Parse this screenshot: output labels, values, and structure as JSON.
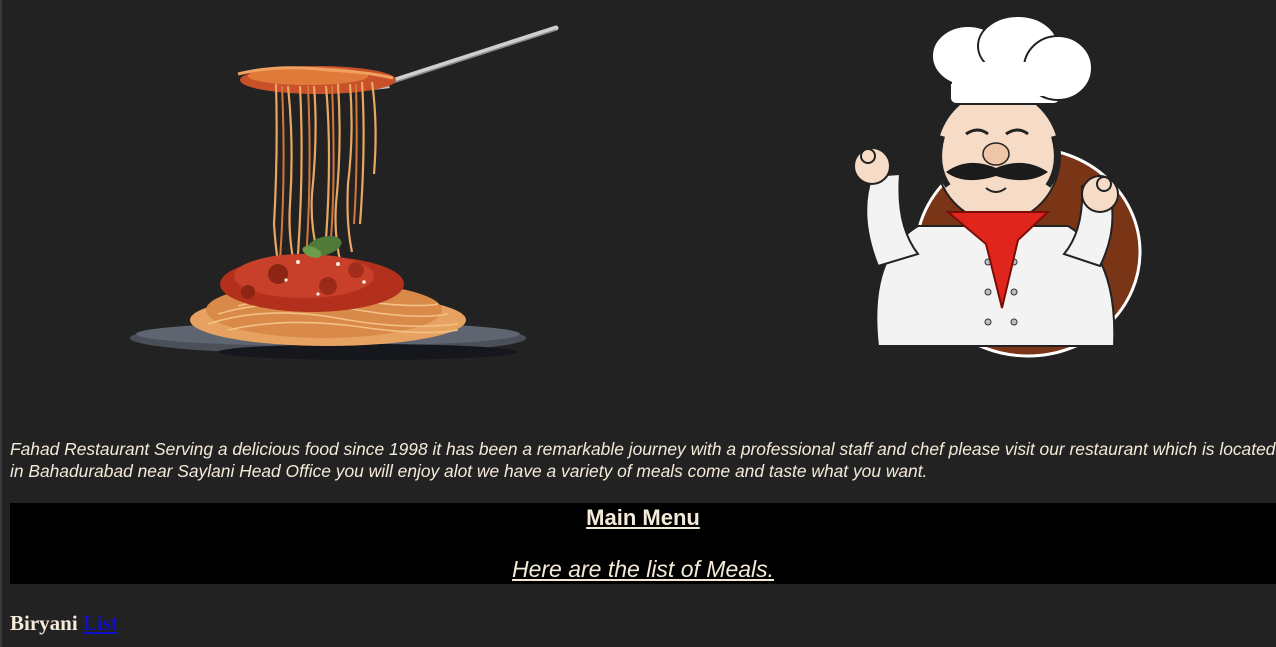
{
  "hero": {
    "pasta_image": "spaghetti-fork-plate-image",
    "chef_image": "chef-mascot-image"
  },
  "intro": {
    "text": "Fahad Restaurant Serving a delicious food since 1998 it has been a remarkable journey with a professional staff and chef please visit our restaurant which is located in Bahadurabad near Saylani Head Office you will enjoy alot we have a variety of meals come and taste what you want."
  },
  "menu": {
    "title": "Main Menu",
    "subtitle": "Here are the list of Meals."
  },
  "items": [
    {
      "name": "Biryani",
      "link_label": "List"
    }
  ],
  "colors": {
    "background": "#222222",
    "banner": "#000000",
    "text": "#f4ead8",
    "link": "#1010cc"
  }
}
